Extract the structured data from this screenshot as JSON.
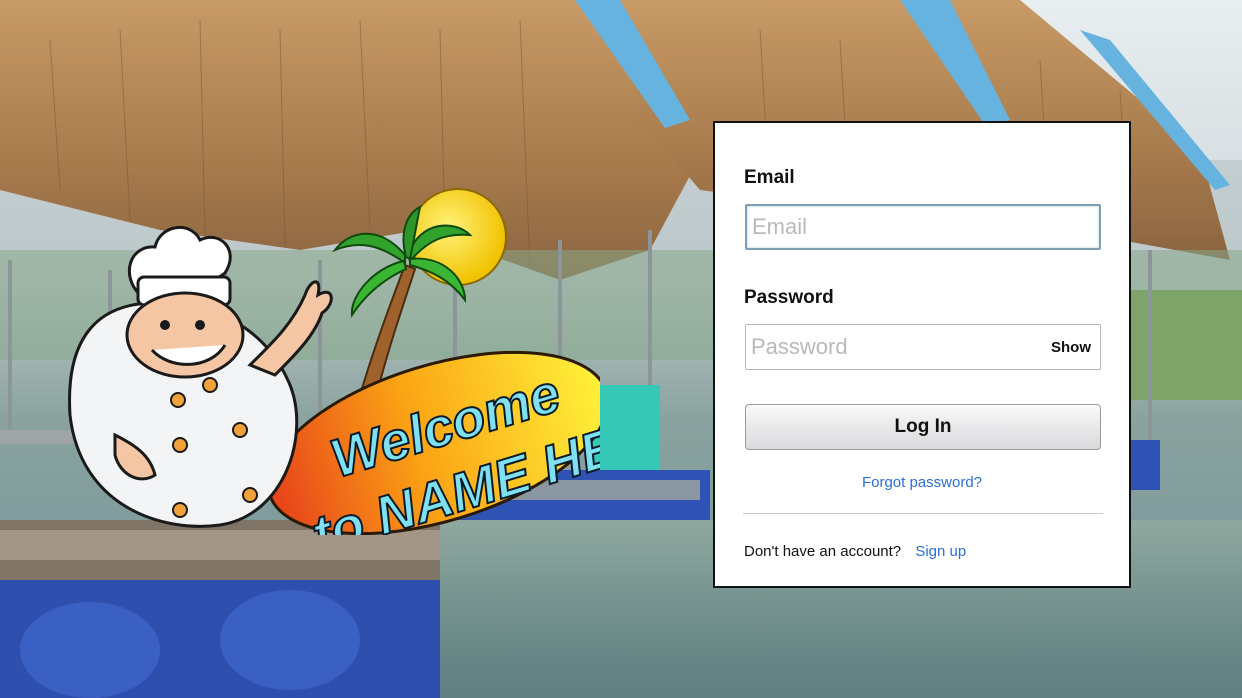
{
  "welcome_logo": {
    "line1": "Welcome",
    "line2": "to NAME HERE"
  },
  "login": {
    "email_label": "Email",
    "email_placeholder": "Email",
    "password_label": "Password",
    "password_placeholder": "Password",
    "show_label": "Show",
    "login_button": "Log In",
    "forgot_link": "Forgot password?",
    "no_account_text": "Don't have an account?",
    "signup_link": "Sign up"
  },
  "colors": {
    "link": "#2a6fd6",
    "card_border": "#111111",
    "email_focus_border": "#7f9fb5"
  }
}
